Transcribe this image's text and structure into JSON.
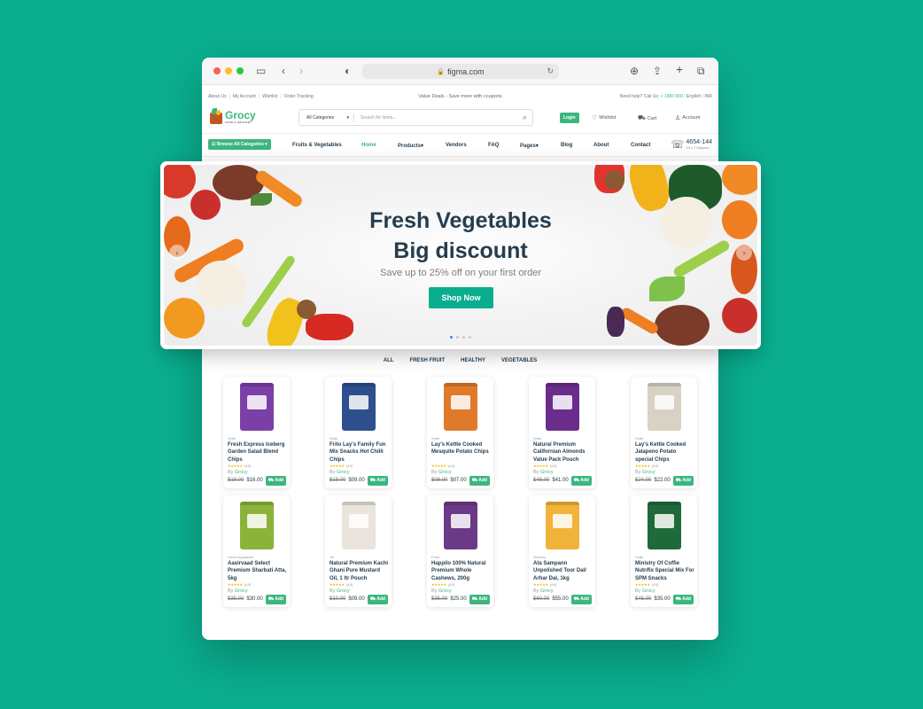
{
  "browser": {
    "url": "figma.com",
    "lock_icon": "lock-icon"
  },
  "topbar": {
    "links": [
      "About Us",
      "My Account",
      "Wishlist",
      "Order Tracking"
    ],
    "promo": "Value Deals - Save more with coupons",
    "help_prefix": "Need help? Call Us:",
    "help_phone": "+ 1800 900",
    "language": "English",
    "currency": "INR"
  },
  "header": {
    "logo_name": "Grocy",
    "logo_tagline": "FOOD & GROCERY",
    "search_category": "All Categories",
    "search_placeholder": "Search for items...",
    "login": "Login",
    "wishlist": "Wishlist",
    "cart": "Cart",
    "account": "Account"
  },
  "nav": {
    "browse": "Browse All Categories",
    "items": [
      "Fruits & Vegetables",
      "Home",
      "Products",
      "Vendors",
      "FAQ",
      "Pages",
      "Blog",
      "About",
      "Contact"
    ],
    "support_number": "4654-144",
    "support_label": "24 x 7 Support"
  },
  "hero": {
    "title_line1": "Fresh Vegetables",
    "title_line2": "Big discount",
    "subtitle": "Save up to 25% off on your first order",
    "cta": "Shop Now",
    "slide_count": 4,
    "active_slide": 1
  },
  "filters": [
    "ALL",
    "FRESH FRUIT",
    "HEALTHY",
    "VEGETABLES"
  ],
  "products": [
    {
      "category": "Snak",
      "name": "Fresh Express Iceberg Garden Salad Blend Chips",
      "rating": "(4.0)",
      "vendor": "Grocy",
      "old_price": "$18.00",
      "price": "$16.00",
      "color": "#7b3fa8"
    },
    {
      "category": "Snak",
      "name": "Frito Lay's Family Fun Mix Snacks Hot Chilli Chips",
      "rating": "(4.0)",
      "vendor": "Grocy",
      "old_price": "$18.00",
      "price": "$09.00",
      "color": "#2d4f8e"
    },
    {
      "category": "Snak",
      "name": "Lay's Kettle Cooked Mesquite Potato Chips",
      "rating": "(4.0)",
      "vendor": "Grocy",
      "old_price": "$08.00",
      "price": "$07.00",
      "color": "#e07a2b"
    },
    {
      "category": "Snak",
      "name": "Natural Premium Californian Almonds Value Pack Pouch",
      "rating": "(4.0)",
      "vendor": "Grocy",
      "old_price": "$46.00",
      "price": "$41.00",
      "color": "#6a2d8c"
    },
    {
      "category": "Snak",
      "name": "Lay's Kettle Cooked Jalapeno Potato special Chips",
      "rating": "(4.0)",
      "vendor": "Grocy",
      "old_price": "$24.00",
      "price": "$22.00",
      "color": "#d8d2c4"
    },
    {
      "category": "Home Appliance",
      "name": "Aasirvaad Select Premium Sharbati Atta, 5kg",
      "rating": "(4.0)",
      "vendor": "Grocy",
      "old_price": "$35.00",
      "price": "$30.00",
      "color": "#8bb33a"
    },
    {
      "category": "Oil",
      "name": "Natural Premium Kachi Ghani Pure Mustard Oil, 1 ltr Pouch",
      "rating": "(4.0)",
      "vendor": "Grocy",
      "old_price": "$10.00",
      "price": "$09.00",
      "color": "#e9e4dc"
    },
    {
      "category": "Food",
      "name": "Happilo 100% Natural Premium Whole Cashews, 200g",
      "rating": "(4.0)",
      "vendor": "Grocy",
      "old_price": "$35.00",
      "price": "$25.00",
      "color": "#6b3a87"
    },
    {
      "category": "Grocery",
      "name": "Ata Sampann Unpolished Toor Dal/ Arhar Dal, 1kg",
      "rating": "(4.0)",
      "vendor": "Grocy",
      "old_price": "$60.00",
      "price": "$55.00",
      "color": "#f2b33a"
    },
    {
      "category": "Snak",
      "name": "Ministry Of Coffie Nutrifix Special Mix For SPM Snacks",
      "rating": "(4.0)",
      "vendor": "Grocy",
      "old_price": "$45.00",
      "price": "$35.00",
      "color": "#1f6a3a"
    }
  ],
  "labels": {
    "by": "By",
    "add": "Add",
    "stars": "★★★★★"
  },
  "colors": {
    "brand": "#3bb77e",
    "background": "#0aae8f",
    "heading": "#253d4e"
  }
}
